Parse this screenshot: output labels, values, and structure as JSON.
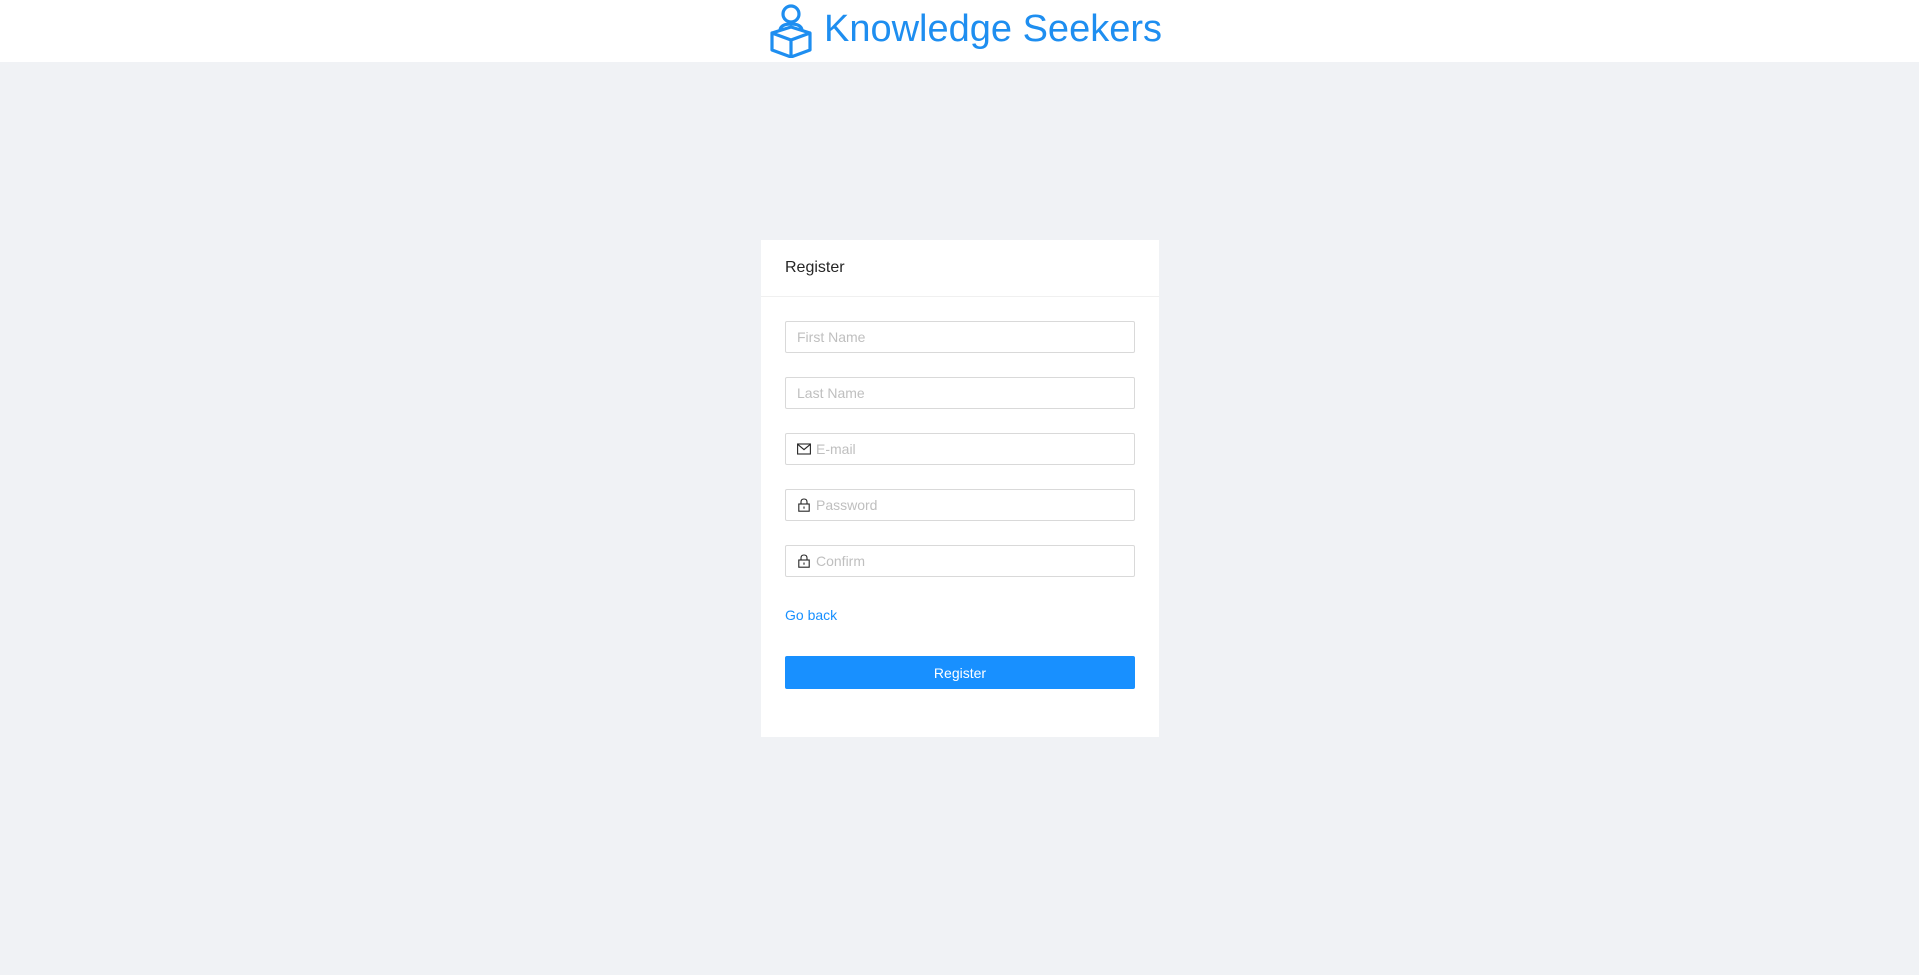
{
  "header": {
    "brand_title": "Knowledge Seekers",
    "brand_icon": "reader-with-open-book-icon",
    "brand_color": "#1e8ef0"
  },
  "register_card": {
    "title": "Register",
    "fields": {
      "first_name": {
        "placeholder": "First Name",
        "value": ""
      },
      "last_name": {
        "placeholder": "Last Name",
        "value": ""
      },
      "email": {
        "placeholder": "E-mail",
        "value": "",
        "icon": "mail-icon"
      },
      "password": {
        "placeholder": "Password",
        "value": "",
        "icon": "lock-icon"
      },
      "confirm": {
        "placeholder": "Confirm",
        "value": "",
        "icon": "lock-icon"
      }
    },
    "go_back_label": "Go back",
    "submit_label": "Register"
  },
  "colors": {
    "accent": "#1890ff",
    "background": "#f0f2f5",
    "card": "#ffffff",
    "input_border": "#d9d9d9",
    "placeholder": "#bfbfbf"
  }
}
